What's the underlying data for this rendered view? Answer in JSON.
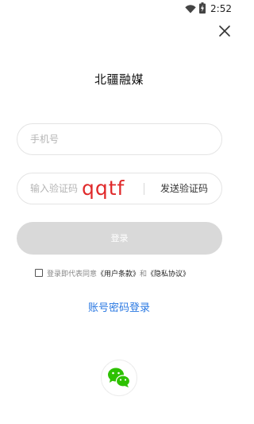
{
  "status_bar": {
    "time": "2:52",
    "wifi_icon": "wifi-icon",
    "battery_icon": "battery-charging-icon"
  },
  "header": {
    "close_icon": "close-icon",
    "title": "北疆融媒"
  },
  "form": {
    "phone_placeholder": "手机号",
    "phone_value": "",
    "code_placeholder": "输入验证码",
    "code_value": "",
    "send_code_label": "发送验证码",
    "login_label": "登录"
  },
  "overlay_text": "qqtf",
  "agreement": {
    "checked": false,
    "prefix": "登录即代表同意",
    "user_terms": "《用户条款》",
    "conjunction": "和",
    "privacy": "《隐私协议》"
  },
  "alt_login_label": "账号密码登录",
  "social": {
    "wechat_icon": "wechat-icon"
  },
  "colors": {
    "accent_blue": "#2a78e2",
    "login_disabled": "#d9d9d9",
    "overlay_red": "#e0292a",
    "wechat_green": "#2dc100"
  }
}
